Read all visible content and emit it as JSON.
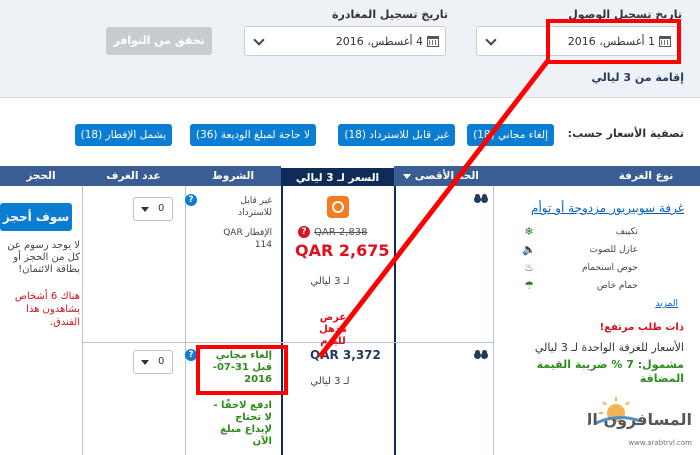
{
  "search": {
    "checkin_label": "تاريخ تسجيل الوصول",
    "checkin_value": "1 أغسطس، 2016",
    "checkout_label": "تاريخ تسجيل المغادرة",
    "checkout_value": "4 أغسطس، 2016",
    "check_button": "تحقق من التوافر",
    "stay_text": "إقامة من 3 ليالي"
  },
  "filters": {
    "label": "تصفية الأسعار حسب:",
    "pills": [
      "إلغاء مجاني (18)",
      "غير قابل للاسترداد (18)",
      "لا حاجة لمبلغ الوديعة (36)",
      "يشمل الإفطار (18)"
    ]
  },
  "table": {
    "headers": {
      "room_type": "نوع الغرفة",
      "max": "الحد الأقصى",
      "price": "السعر لـ 3 ليالي",
      "conditions": "الشروط",
      "rooms": "عدد الغرف",
      "booking": "الحجز"
    },
    "room": {
      "name": "غرفة سوبيريور مزدوجة أو توأم",
      "features": [
        "تكييف",
        "عازل للصوت",
        "حوض استحمام",
        "حمام خاص"
      ],
      "more": "المزيد",
      "high_demand": "ذات طلب مرتفع!",
      "price_note": "الأسعار للغرفة الواحدة لـ 3 ليالي",
      "tax_note": "مشمول: 7 % ضريبة القيمة المضافة"
    },
    "row1": {
      "old_price": "QAR 2,838",
      "price": "QAR 2,675",
      "nights": "لـ 3 ليالي",
      "deal": "عرض مذهل لليوم",
      "cond1": "غير قابل للاسترداد",
      "cond2": "الإفطار QAR 114",
      "qty": "0"
    },
    "row2": {
      "price": "QAR 3,372",
      "nights": "لـ 3 ليالي",
      "cond1": "إلغاء مجاني قبل 31-07-2016",
      "cond2": "ادفع لاحقًا - لا تحتاج لإيداع مبلغ الآن",
      "qty": "0"
    },
    "booking": {
      "button": "سوف أحجز",
      "line1": "لا يوجد رسوم عن",
      "line2": "كل من الحجز أو",
      "line3": "بطاقة الائتمان!",
      "alert": "هناك 6 أشخاص يشاهدون هذا الفندق."
    }
  },
  "watermark": {
    "text": "المسافرون العرب",
    "url": "www.arabtrvl.com"
  },
  "colors": {
    "accent": "#0b7dd3",
    "header": "#3a5d93",
    "annotation": "#ff0000",
    "price_red": "#e0101e",
    "green": "#2e8b1e"
  }
}
